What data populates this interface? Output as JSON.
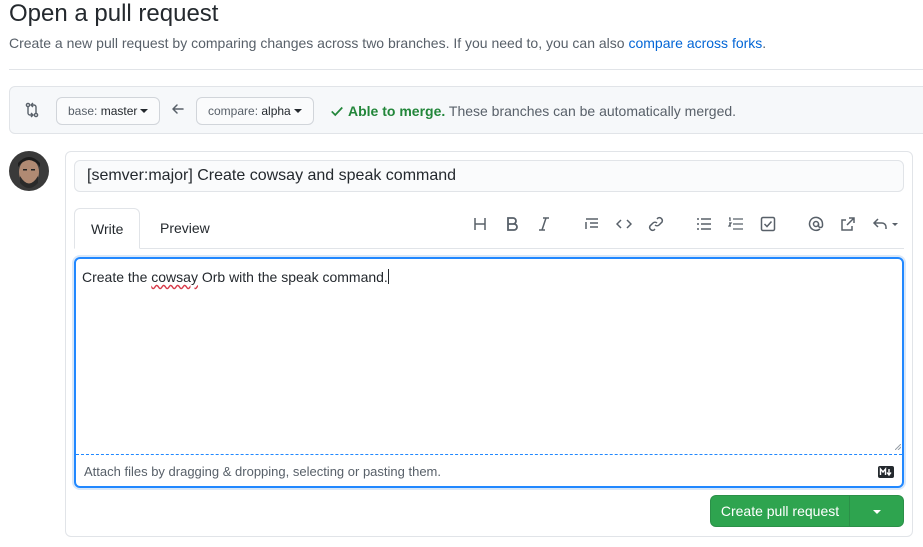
{
  "page": {
    "title": "Open a pull request",
    "subtitle_prefix": "Create a new pull request by comparing changes across two branches. If you need to, you can also ",
    "subtitle_link": "compare across forks",
    "subtitle_suffix": "."
  },
  "range": {
    "base_prefix": "base: ",
    "base_value": "master",
    "compare_prefix": "compare: ",
    "compare_value": "alpha",
    "merge_ok": "Able to merge.",
    "merge_text": " These branches can be automatically merged."
  },
  "form": {
    "title_value": "[semver:major] Create cowsay and speak command",
    "tabs": [
      "Write",
      "Preview"
    ],
    "body_prefix": "Create the ",
    "body_misspelled": "cowsay",
    "body_suffix": " Orb with the speak command.",
    "attach_text": "Attach files by dragging & dropping, selecting or pasting them.",
    "create_label": "Create pull request"
  },
  "toolbar_icons": [
    "heading-icon",
    "bold-icon",
    "italic-icon",
    "quote-icon",
    "code-icon",
    "link-icon",
    "unordered-list-icon",
    "ordered-list-icon",
    "task-list-icon",
    "mention-icon",
    "reference-icon",
    "reply-icon"
  ],
  "colors": {
    "primary_button": "#2ea44f",
    "link": "#0366d6",
    "success": "#22863a",
    "focus": "#2188ff"
  }
}
